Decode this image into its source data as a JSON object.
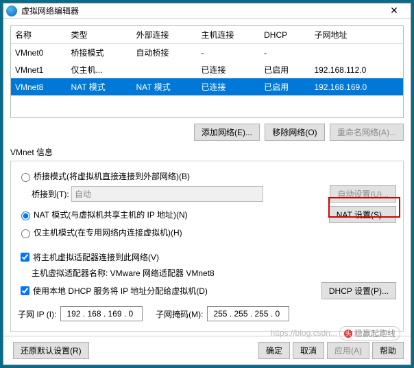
{
  "title": "虚拟网络编辑器",
  "columns": [
    "名称",
    "类型",
    "外部连接",
    "主机连接",
    "DHCP",
    "子网地址"
  ],
  "rows": [
    {
      "name": "VMnet0",
      "type": "桥接模式",
      "ext": "自动桥接",
      "host": "-",
      "dhcp": "-",
      "subnet": ""
    },
    {
      "name": "VMnet1",
      "type": "仅主机...",
      "ext": "",
      "host": "已连接",
      "dhcp": "已启用",
      "subnet": "192.168.112.0"
    },
    {
      "name": "VMnet8",
      "type": "NAT 模式",
      "ext": "NAT 模式",
      "host": "已连接",
      "dhcp": "已启用",
      "subnet": "192.168.169.0"
    }
  ],
  "buttons": {
    "addNet": "添加网络(E)...",
    "removeNet": "移除网络(O)",
    "renameNet": "重命名网络(A)..."
  },
  "info_label": "VMnet 信息",
  "radios": {
    "bridge": "桥接模式(将虚拟机直接连接到外部网络)(B)",
    "bridge_to": "桥接到(T):",
    "bridge_auto": "自动",
    "auto_set": "自动设置(U)...",
    "nat": "NAT 模式(与虚拟机共享主机的 IP 地址)(N)",
    "nat_set": "NAT 设置(S)...",
    "hostonly": "仅主机模式(在专用网络内连接虚拟机)(H)"
  },
  "checks": {
    "connect": "将主机虚拟适配器连接到此网络(V)",
    "adapter": "主机虚拟适配器名称: VMware 网络适配器 VMnet8",
    "dhcp": "使用本地 DHCP 服务将 IP 地址分配给虚拟机(D)",
    "dhcp_set": "DHCP 设置(P)..."
  },
  "ip": {
    "subnet_label": "子网 IP (I):",
    "subnet": "192 . 168 . 169 .  0",
    "mask_label": "子网掩码(M):",
    "mask": "255 . 255 . 255 .  0"
  },
  "footer": {
    "restore": "还原默认设置(R)",
    "ok": "确定",
    "cancel": "取消",
    "apply": "应用(A)",
    "help": "帮助"
  },
  "watermark": "https://blog.csdn...",
  "wm_badge": "稳赢起跑线"
}
